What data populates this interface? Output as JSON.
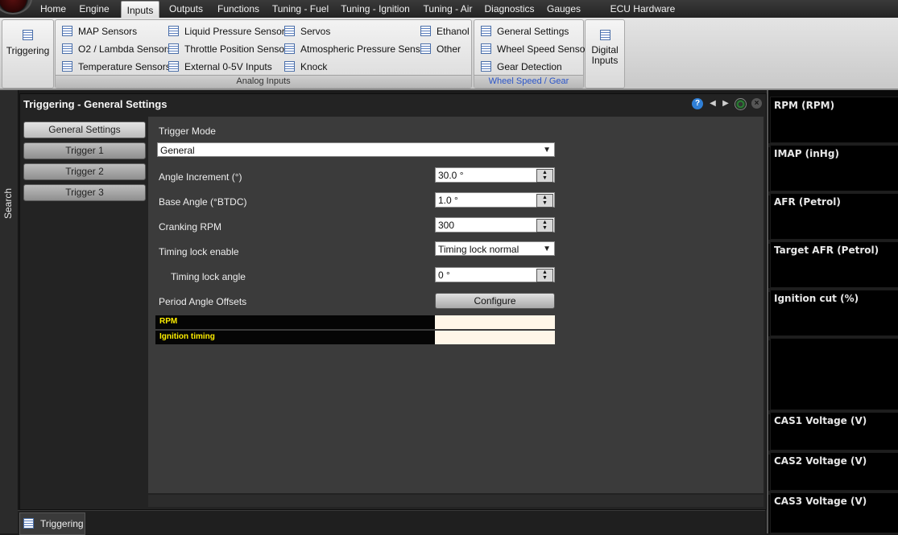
{
  "menu": {
    "tabs": [
      "Home",
      "Engine",
      "Inputs",
      "Outputs",
      "Functions",
      "Tuning - Fuel",
      "Tuning - Ignition",
      "Tuning - Air",
      "Diagnostics",
      "Gauges",
      "ECU Hardware Settings"
    ],
    "active": "Inputs"
  },
  "ribbon": {
    "triggering": "Triggering",
    "analog": {
      "label": "Analog Inputs",
      "items": [
        "MAP Sensors",
        "O2 / Lambda Sensors",
        "Temperature Sensors",
        "Liquid Pressure Sensors",
        "Throttle Position Sensor",
        "External 0-5V Inputs",
        "Servos",
        "Atmospheric Pressure Sensor",
        "Knock",
        "Ethanol",
        "Other"
      ]
    },
    "wheel": {
      "label": "Wheel Speed / Gear",
      "items": [
        "General Settings",
        "Wheel Speed Sensor",
        "Gear Detection"
      ]
    },
    "digital_line1": "Digital",
    "digital_line2": "Inputs"
  },
  "search_label": "Search",
  "panel": {
    "title": "Triggering - General Settings",
    "nav": [
      "General Settings",
      "Trigger 1",
      "Trigger 2",
      "Trigger 3"
    ],
    "trigger_mode": {
      "label": "Trigger Mode",
      "value": "General"
    },
    "angle_increment": {
      "label": "Angle Increment (°)",
      "value": "30.0 °"
    },
    "base_angle": {
      "label": "Base Angle (°BTDC)",
      "value": "1.0 °"
    },
    "cranking_rpm": {
      "label": "Cranking RPM",
      "value": "300"
    },
    "timing_lock_enable": {
      "label": "Timing lock enable",
      "value": "Timing lock normal"
    },
    "timing_lock_angle": {
      "label": "Timing lock angle",
      "value": "0 °"
    },
    "period_offsets": {
      "label": "Period Angle Offsets",
      "button": "Configure"
    },
    "offset_rows": [
      "RPM",
      "Ignition timing"
    ]
  },
  "bottom_tab": "Triggering",
  "gauges": [
    "RPM (RPM)",
    "IMAP  (inHg)",
    "AFR (Petrol)",
    "Target AFR (Petrol)",
    "Ignition cut (%)",
    "CAS1 Voltage (V)",
    "CAS2 Voltage (V)",
    "CAS3 Voltage (V)"
  ],
  "colors": {
    "offset_label": "#ffee00",
    "help_icon": "#2f7fd6",
    "wheel_group_label": "#2b55c8"
  },
  "icons": {
    "list": "list-icon",
    "help": "help-icon",
    "prev": "prev-icon",
    "next": "next-icon",
    "gauge": "gauge-icon",
    "close": "close-icon"
  }
}
